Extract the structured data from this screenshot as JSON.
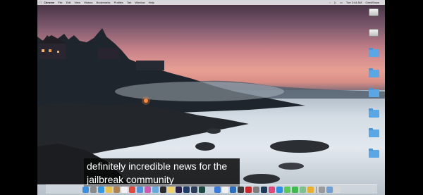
{
  "menubar": {
    "apple_icon": "apple-icon",
    "app_name": "Chrome",
    "items": [
      "File",
      "Edit",
      "View",
      "History",
      "Bookmarks",
      "Profiles",
      "Tab",
      "Window",
      "Help"
    ],
    "clock": "Tue 3:44 AM",
    "user": "GeekSnow"
  },
  "desktop_icons": [
    {
      "type": "drive"
    },
    {
      "type": "drive"
    },
    {
      "type": "folder"
    },
    {
      "type": "folder"
    },
    {
      "type": "folder"
    },
    {
      "type": "folder"
    },
    {
      "type": "folder"
    },
    {
      "type": "folder"
    }
  ],
  "caption": {
    "line1": "definitely incredible news for the",
    "line2": "jailbreak community"
  },
  "dock": {
    "icons": [
      {
        "name": "finder-icon",
        "color": "#3d8fe0"
      },
      {
        "name": "launchpad-icon",
        "color": "#8a8a8a"
      },
      {
        "name": "safari-icon",
        "color": "#2f9be6"
      },
      {
        "name": "photos-icon",
        "color": "#e9c24a"
      },
      {
        "name": "contacts-icon",
        "color": "#b3834d"
      },
      {
        "name": "calendar-icon",
        "color": "#f2f2f2"
      },
      {
        "name": "chrome-icon",
        "color": "#e5493a"
      },
      {
        "name": "mail-icon",
        "color": "#4f94d9"
      },
      {
        "name": "itunes-icon",
        "color": "#d05ab0"
      },
      {
        "name": "folder-icon",
        "color": "#6aa9e0"
      },
      {
        "name": "terminal-icon",
        "color": "#2b2b2b"
      },
      {
        "name": "notes-icon",
        "color": "#f0d36a"
      },
      {
        "name": "premiere-icon",
        "color": "#2a1f4a"
      },
      {
        "name": "photoshop-icon",
        "color": "#1f3b66"
      },
      {
        "name": "lightroom-icon",
        "color": "#2a3d5a"
      },
      {
        "name": "audition-icon",
        "color": "#1c4a43"
      },
      {
        "name": "preview-icon",
        "color": "#c9d6e2"
      },
      {
        "name": "keynote-icon",
        "color": "#3a7ad9"
      },
      {
        "name": "textedit-icon",
        "color": "#f1f1f1"
      },
      {
        "name": "xcode-icon",
        "color": "#2d6fbf"
      },
      {
        "name": "github-icon",
        "color": "#3b3b3b"
      },
      {
        "name": "opera-icon",
        "color": "#cc2a2a"
      },
      {
        "name": "system-prefs-icon",
        "color": "#7d7d7d"
      },
      {
        "name": "steam-icon",
        "color": "#203a5a"
      },
      {
        "name": "music-icon",
        "color": "#e4477a"
      },
      {
        "name": "appstore-icon",
        "color": "#2e8de5"
      },
      {
        "name": "messages-icon",
        "color": "#5acb5a"
      },
      {
        "name": "facetime-icon",
        "color": "#3fba4f"
      },
      {
        "name": "maps-icon",
        "color": "#7dc18f"
      },
      {
        "name": "chrome-canary-icon",
        "color": "#e9b12b"
      },
      {
        "name": "settings-icon",
        "color": "#9a9a9a"
      },
      {
        "name": "downloads-icon",
        "color": "#6f9fd6"
      },
      {
        "name": "trash-icon",
        "color": "#d8d8d8"
      }
    ]
  }
}
